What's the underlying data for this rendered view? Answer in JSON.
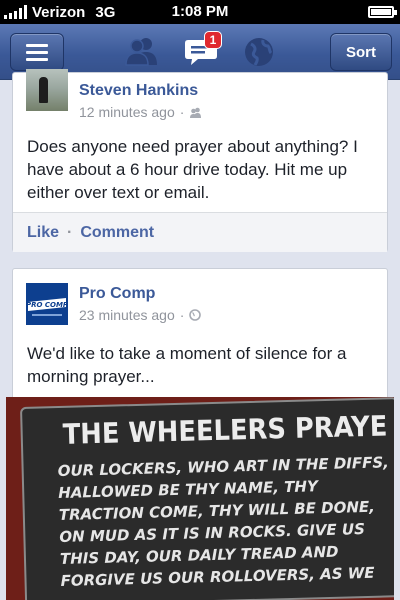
{
  "status_bar": {
    "carrier": "Verizon",
    "network": "3G",
    "time": "1:08 PM"
  },
  "nav": {
    "message_badge": "1",
    "sort_label": "Sort"
  },
  "posts": [
    {
      "author": "Steven Hankins",
      "time": "12 minutes ago",
      "privacy_icon": "friends-icon",
      "text": "Does anyone need prayer about anything?  I have about a 6 hour drive today.  Hit me up either over text or email.",
      "like_label": "Like",
      "comment_label": "Comment"
    },
    {
      "author": "Pro Comp",
      "time": "23 minutes ago",
      "privacy_icon": "globe-icon",
      "text": "We'd like to take a moment of silence for a morning prayer...",
      "photo": {
        "title": "THE WHEELERS PRAYE",
        "lines": [
          "OUR LOCKERS, WHO ART IN THE DIFFS,",
          "HALLOWED BE THY NAME, THY",
          "TRACTION COME, THY WILL BE DONE,",
          "ON MUD AS IT IS IN ROCKS. GIVE US",
          "THIS DAY, OUR DAILY TREAD AND",
          "FORGIVE US OUR ROLLOVERS, AS WE"
        ]
      }
    }
  ],
  "colors": {
    "nav_blue": "#3b5998",
    "link": "#3b5998",
    "badge": "#e0292f"
  }
}
